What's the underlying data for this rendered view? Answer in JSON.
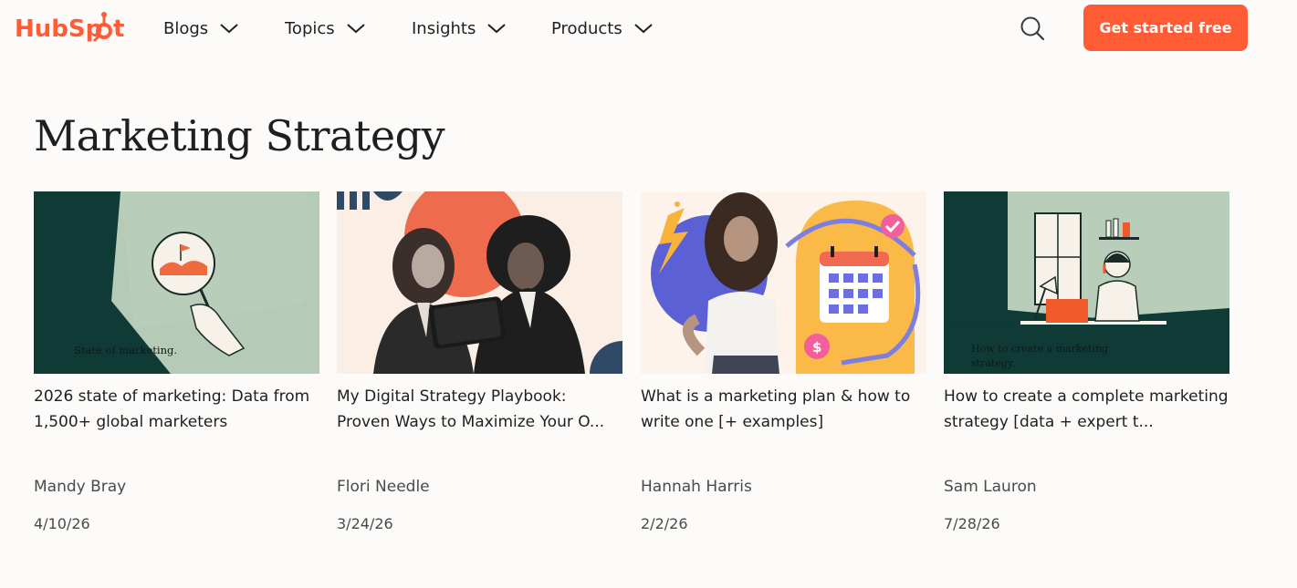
{
  "header": {
    "logo_text": "HubSpot",
    "nav": [
      {
        "label": "Blogs",
        "icon": "chevron-down-icon"
      },
      {
        "label": "Topics",
        "icon": "chevron-down-icon"
      },
      {
        "label": "Insights",
        "icon": "chevron-down-icon"
      },
      {
        "label": "Products",
        "icon": "chevron-down-icon"
      }
    ],
    "search_icon": "search-icon",
    "cta_label": "Get started free"
  },
  "page": {
    "title": "Marketing Strategy"
  },
  "articles": [
    {
      "title": "2026 state of marketing: Data from 1,500+ global marketers",
      "author": "Mandy Bray",
      "date": "4/10/26",
      "image_caption": "State of marketing."
    },
    {
      "title": "My Digital Strategy Playbook: Proven Ways to Maximize Your O...",
      "author": "Flori Needle",
      "date": "3/24/26"
    },
    {
      "title": "What is a marketing plan & how to write one [+ examples]",
      "author": "Hannah Harris",
      "date": "2/2/26"
    },
    {
      "title": "How to create a complete marketing strategy [data + expert t...",
      "author": "Sam Lauron",
      "date": "7/28/26",
      "image_caption": "How to create a marketing strategy."
    }
  ],
  "colors": {
    "brand": "#ff5c35",
    "background": "#fcfbf9",
    "text": "#1f1f1f",
    "muted": "#4a4a4a"
  }
}
